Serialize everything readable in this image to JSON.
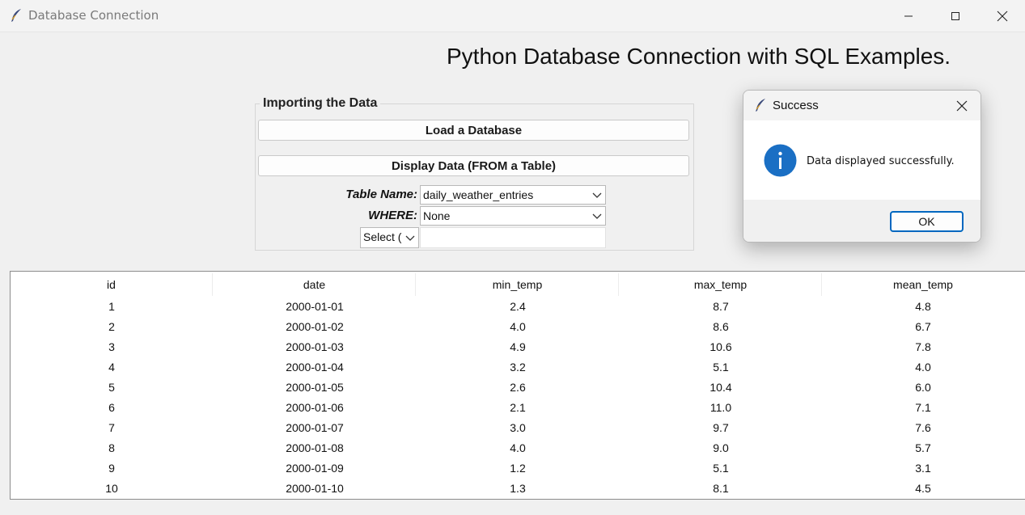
{
  "window": {
    "title": "Database Connection",
    "minimize_icon": "minimize-icon",
    "maximize_icon": "maximize-icon",
    "close_icon": "close-icon"
  },
  "main": {
    "heading": "Python Database Connection with SQL Examples."
  },
  "import_group": {
    "legend": "Importing the Data",
    "load_button": "Load a Database",
    "display_button": "Display Data (FROM a Table)",
    "table_name_label": "Table Name:",
    "table_name_value": "daily_weather_entries",
    "where_label": "WHERE:",
    "where_value": "None",
    "select_value": "Select (",
    "condition_value": ""
  },
  "table": {
    "columns": [
      "id",
      "date",
      "min_temp",
      "max_temp",
      "mean_temp"
    ],
    "rows": [
      [
        "1",
        "2000-01-01",
        "2.4",
        "8.7",
        "4.8"
      ],
      [
        "2",
        "2000-01-02",
        "4.0",
        "8.6",
        "6.7"
      ],
      [
        "3",
        "2000-01-03",
        "4.9",
        "10.6",
        "7.8"
      ],
      [
        "4",
        "2000-01-04",
        "3.2",
        "5.1",
        "4.0"
      ],
      [
        "5",
        "2000-01-05",
        "2.6",
        "10.4",
        "6.0"
      ],
      [
        "6",
        "2000-01-06",
        "2.1",
        "11.0",
        "7.1"
      ],
      [
        "7",
        "2000-01-07",
        "3.0",
        "9.7",
        "7.6"
      ],
      [
        "8",
        "2000-01-08",
        "4.0",
        "9.0",
        "5.7"
      ],
      [
        "9",
        "2000-01-09",
        "1.2",
        "5.1",
        "3.1"
      ],
      [
        "10",
        "2000-01-10",
        "1.3",
        "8.1",
        "4.5"
      ]
    ]
  },
  "dialog": {
    "title": "Success",
    "message": "Data displayed successfully.",
    "ok_label": "OK",
    "icon": "info-icon",
    "accent": "#0067c0"
  }
}
